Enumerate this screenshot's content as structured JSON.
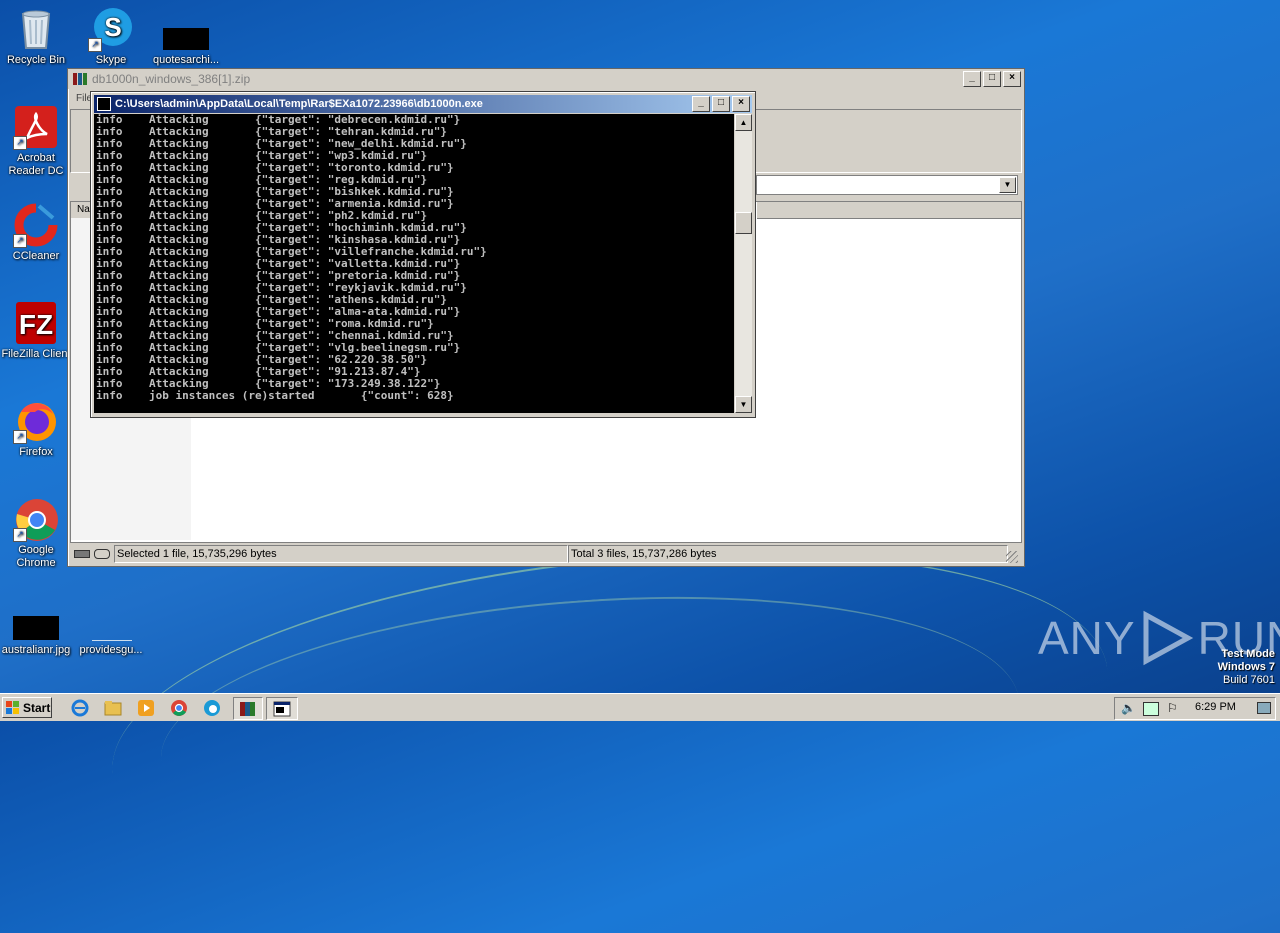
{
  "desktop": {
    "icons": [
      {
        "label": "Recycle Bin"
      },
      {
        "label": "Skype"
      },
      {
        "label": "quotesarchi..."
      },
      {
        "label": "Acrobat Reader DC"
      },
      {
        "label": "CCleaner"
      },
      {
        "label": "FileZilla Client"
      },
      {
        "label": "Firefox"
      },
      {
        "label": "Google Chrome"
      },
      {
        "label": "australianr.jpg"
      },
      {
        "label": "providesgu..."
      }
    ],
    "watermark": {
      "brand": "ANY",
      "brand2": "RUN"
    },
    "test_mode": {
      "line1": "Test Mode",
      "line2": "Windows 7",
      "line3": "Build 7601"
    }
  },
  "winrar": {
    "title": "db1000n_windows_386[1].zip",
    "menu_fragment": "File",
    "column_fragment": "Na",
    "status_left": "Selected 1 file, 15,735,296 bytes",
    "status_right": "Total 3 files, 15,737,286 bytes"
  },
  "console": {
    "title": "C:\\Users\\admin\\AppData\\Local\\Temp\\Rar$EXa1072.23966\\db1000n.exe",
    "lines": [
      "info    Attacking       {\"target\": \"debrecen.kdmid.ru\"}",
      "info    Attacking       {\"target\": \"tehran.kdmid.ru\"}",
      "info    Attacking       {\"target\": \"new_delhi.kdmid.ru\"}",
      "info    Attacking       {\"target\": \"wp3.kdmid.ru\"}",
      "info    Attacking       {\"target\": \"toronto.kdmid.ru\"}",
      "info    Attacking       {\"target\": \"reg.kdmid.ru\"}",
      "info    Attacking       {\"target\": \"bishkek.kdmid.ru\"}",
      "info    Attacking       {\"target\": \"armenia.kdmid.ru\"}",
      "info    Attacking       {\"target\": \"ph2.kdmid.ru\"}",
      "info    Attacking       {\"target\": \"hochiminh.kdmid.ru\"}",
      "info    Attacking       {\"target\": \"kinshasa.kdmid.ru\"}",
      "info    Attacking       {\"target\": \"villefranche.kdmid.ru\"}",
      "info    Attacking       {\"target\": \"valletta.kdmid.ru\"}",
      "info    Attacking       {\"target\": \"pretoria.kdmid.ru\"}",
      "info    Attacking       {\"target\": \"reykjavik.kdmid.ru\"}",
      "info    Attacking       {\"target\": \"athens.kdmid.ru\"}",
      "info    Attacking       {\"target\": \"alma-ata.kdmid.ru\"}",
      "info    Attacking       {\"target\": \"roma.kdmid.ru\"}",
      "info    Attacking       {\"target\": \"chennai.kdmid.ru\"}",
      "info    Attacking       {\"target\": \"vlg.beelinegsm.ru\"}",
      "info    Attacking       {\"target\": \"62.220.38.50\"}",
      "info    Attacking       {\"target\": \"91.213.87.4\"}",
      "info    Attacking       {\"target\": \"173.249.38.122\"}",
      "info    job instances (re)started       {\"count\": 628}"
    ]
  },
  "taskbar": {
    "start_label": "Start",
    "clock": "6:29 PM"
  },
  "colors": {
    "console_bg": "#000000",
    "console_fg": "#c0c0c0",
    "title_active": "#0a246a"
  }
}
